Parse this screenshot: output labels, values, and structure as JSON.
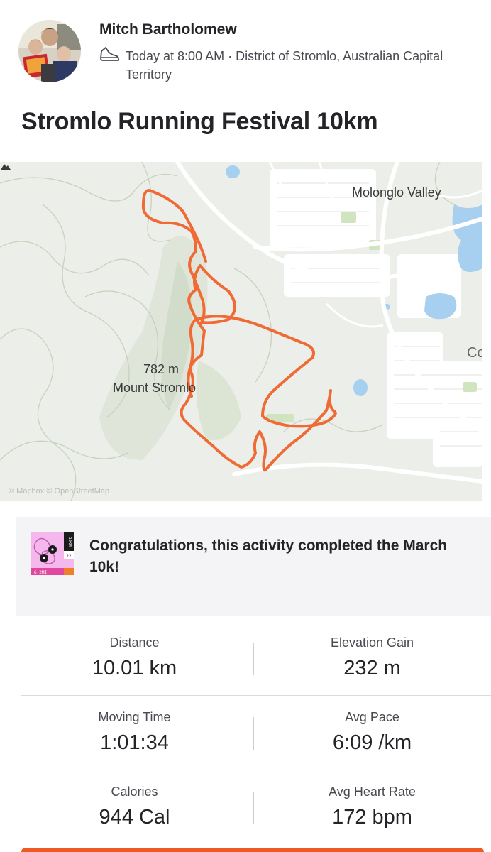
{
  "athlete": {
    "name": "Mitch Bartholomew",
    "meta": "Today at 8:00 AM · District of Stromlo, Australian Capital Territory"
  },
  "activity": {
    "title": "Stromlo Running Festival 10km"
  },
  "map": {
    "labels": {
      "suburb": "Molonglo Valley",
      "peak_elevation": "782 m",
      "peak_name": "Mount Stromlo",
      "edge_cut": "Co",
      "attribution": "© Mapbox © OpenStreetMap"
    },
    "route_color": "#f06a35",
    "water_color": "#a7d0f0",
    "park_color": "#cfe4bf"
  },
  "achievement": {
    "text": "Congratulations, this activity completed the March 10k!",
    "badge": {
      "title": "10KM",
      "number": "22",
      "distance": "6.2MI"
    }
  },
  "stats": [
    [
      {
        "label": "Distance",
        "value": "10.01 km"
      },
      {
        "label": "Elevation Gain",
        "value": "232 m"
      }
    ],
    [
      {
        "label": "Moving Time",
        "value": "1:01:34"
      },
      {
        "label": "Avg Pace",
        "value": "6:09 /km"
      }
    ],
    [
      {
        "label": "Calories",
        "value": "944 Cal"
      },
      {
        "label": "Avg Heart Rate",
        "value": "172 bpm"
      }
    ]
  ],
  "colors": {
    "accent": "#fc5200",
    "text": "#242428"
  }
}
